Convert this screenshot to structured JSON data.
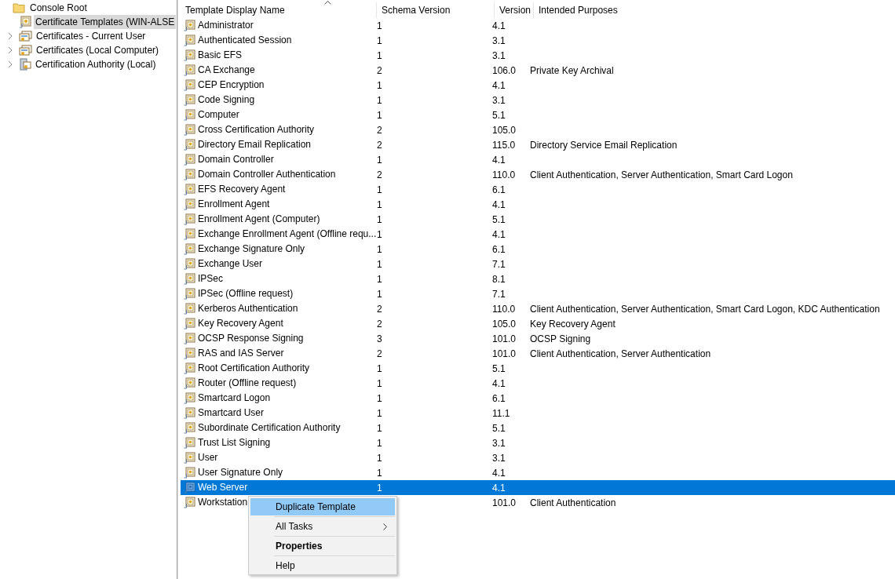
{
  "tree": {
    "root": "Console Root",
    "items": [
      {
        "label": "Certificate Templates (WIN-ALSE",
        "selected": true,
        "expandable": false,
        "kind": "template"
      },
      {
        "label": "Certificates - Current User",
        "selected": false,
        "expandable": true,
        "kind": "store"
      },
      {
        "label": "Certificates (Local Computer)",
        "selected": false,
        "expandable": true,
        "kind": "store"
      },
      {
        "label": "Certification Authority (Local)",
        "selected": false,
        "expandable": true,
        "kind": "authority"
      }
    ]
  },
  "table": {
    "columns": [
      "Template Display Name",
      "Schema Version",
      "Version",
      "Intended Purposes"
    ],
    "rows": [
      {
        "name": "Administrator",
        "schema": "1",
        "version": "4.1",
        "selected": false
      },
      {
        "name": "Authenticated Session",
        "schema": "1",
        "version": "3.1",
        "selected": false
      },
      {
        "name": "Basic EFS",
        "schema": "1",
        "version": "3.1",
        "selected": false
      },
      {
        "name": "CA Exchange",
        "schema": "2",
        "version": "106.0",
        "purposes": "Private Key Archival",
        "selected": false
      },
      {
        "name": "CEP Encryption",
        "schema": "1",
        "version": "4.1",
        "selected": false
      },
      {
        "name": "Code Signing",
        "schema": "1",
        "version": "3.1",
        "selected": false
      },
      {
        "name": "Computer",
        "schema": "1",
        "version": "5.1",
        "selected": false
      },
      {
        "name": "Cross Certification Authority",
        "schema": "2",
        "version": "105.0",
        "selected": false
      },
      {
        "name": "Directory Email Replication",
        "schema": "2",
        "version": "115.0",
        "purposes": "Directory Service Email Replication",
        "selected": false
      },
      {
        "name": "Domain Controller",
        "schema": "1",
        "version": "4.1",
        "selected": false
      },
      {
        "name": "Domain Controller Authentication",
        "schema": "2",
        "version": "110.0",
        "purposes": "Client Authentication, Server Authentication, Smart Card Logon",
        "selected": false
      },
      {
        "name": "EFS Recovery Agent",
        "schema": "1",
        "version": "6.1",
        "selected": false
      },
      {
        "name": "Enrollment Agent",
        "schema": "1",
        "version": "4.1",
        "selected": false
      },
      {
        "name": "Enrollment Agent (Computer)",
        "schema": "1",
        "version": "5.1",
        "selected": false
      },
      {
        "name": "Exchange Enrollment Agent (Offline requ...",
        "schema": "1",
        "version": "4.1",
        "selected": false
      },
      {
        "name": "Exchange Signature Only",
        "schema": "1",
        "version": "6.1",
        "selected": false
      },
      {
        "name": "Exchange User",
        "schema": "1",
        "version": "7.1",
        "selected": false
      },
      {
        "name": "IPSec",
        "schema": "1",
        "version": "8.1",
        "selected": false
      },
      {
        "name": "IPSec (Offline request)",
        "schema": "1",
        "version": "7.1",
        "selected": false
      },
      {
        "name": "Kerberos Authentication",
        "schema": "2",
        "version": "110.0",
        "purposes": "Client Authentication, Server Authentication, Smart Card Logon, KDC Authentication",
        "selected": false
      },
      {
        "name": "Key Recovery Agent",
        "schema": "2",
        "version": "105.0",
        "purposes": "Key Recovery Agent",
        "selected": false
      },
      {
        "name": "OCSP Response Signing",
        "schema": "3",
        "version": "101.0",
        "purposes": "OCSP Signing",
        "selected": false
      },
      {
        "name": "RAS and IAS Server",
        "schema": "2",
        "version": "101.0",
        "purposes": "Client Authentication, Server Authentication",
        "selected": false
      },
      {
        "name": "Root Certification Authority",
        "schema": "1",
        "version": "5.1",
        "selected": false
      },
      {
        "name": "Router (Offline request)",
        "schema": "1",
        "version": "4.1",
        "selected": false
      },
      {
        "name": "Smartcard Logon",
        "schema": "1",
        "version": "6.1",
        "selected": false
      },
      {
        "name": "Smartcard User",
        "schema": "1",
        "version": "11.1",
        "selected": false
      },
      {
        "name": "Subordinate Certification Authority",
        "schema": "1",
        "version": "5.1",
        "selected": false
      },
      {
        "name": "Trust List Signing",
        "schema": "1",
        "version": "3.1",
        "selected": false
      },
      {
        "name": "User",
        "schema": "1",
        "version": "3.1",
        "selected": false
      },
      {
        "name": "User Signature Only",
        "schema": "1",
        "version": "4.1",
        "selected": false
      },
      {
        "name": "Web Server",
        "schema": "1",
        "version": "4.1",
        "selected": true
      },
      {
        "name": "Workstation",
        "version": "101.0",
        "purposes": "Client Authentication",
        "selected": false
      }
    ]
  },
  "context_menu": {
    "items": [
      {
        "label": "Duplicate Template",
        "selected": true,
        "bold": false,
        "submenu": false
      },
      {
        "label": "All Tasks",
        "selected": false,
        "bold": false,
        "submenu": true
      },
      {
        "label": "Properties",
        "selected": false,
        "bold": true,
        "submenu": false
      },
      {
        "label": "Help",
        "selected": false,
        "bold": false,
        "submenu": false
      }
    ]
  }
}
